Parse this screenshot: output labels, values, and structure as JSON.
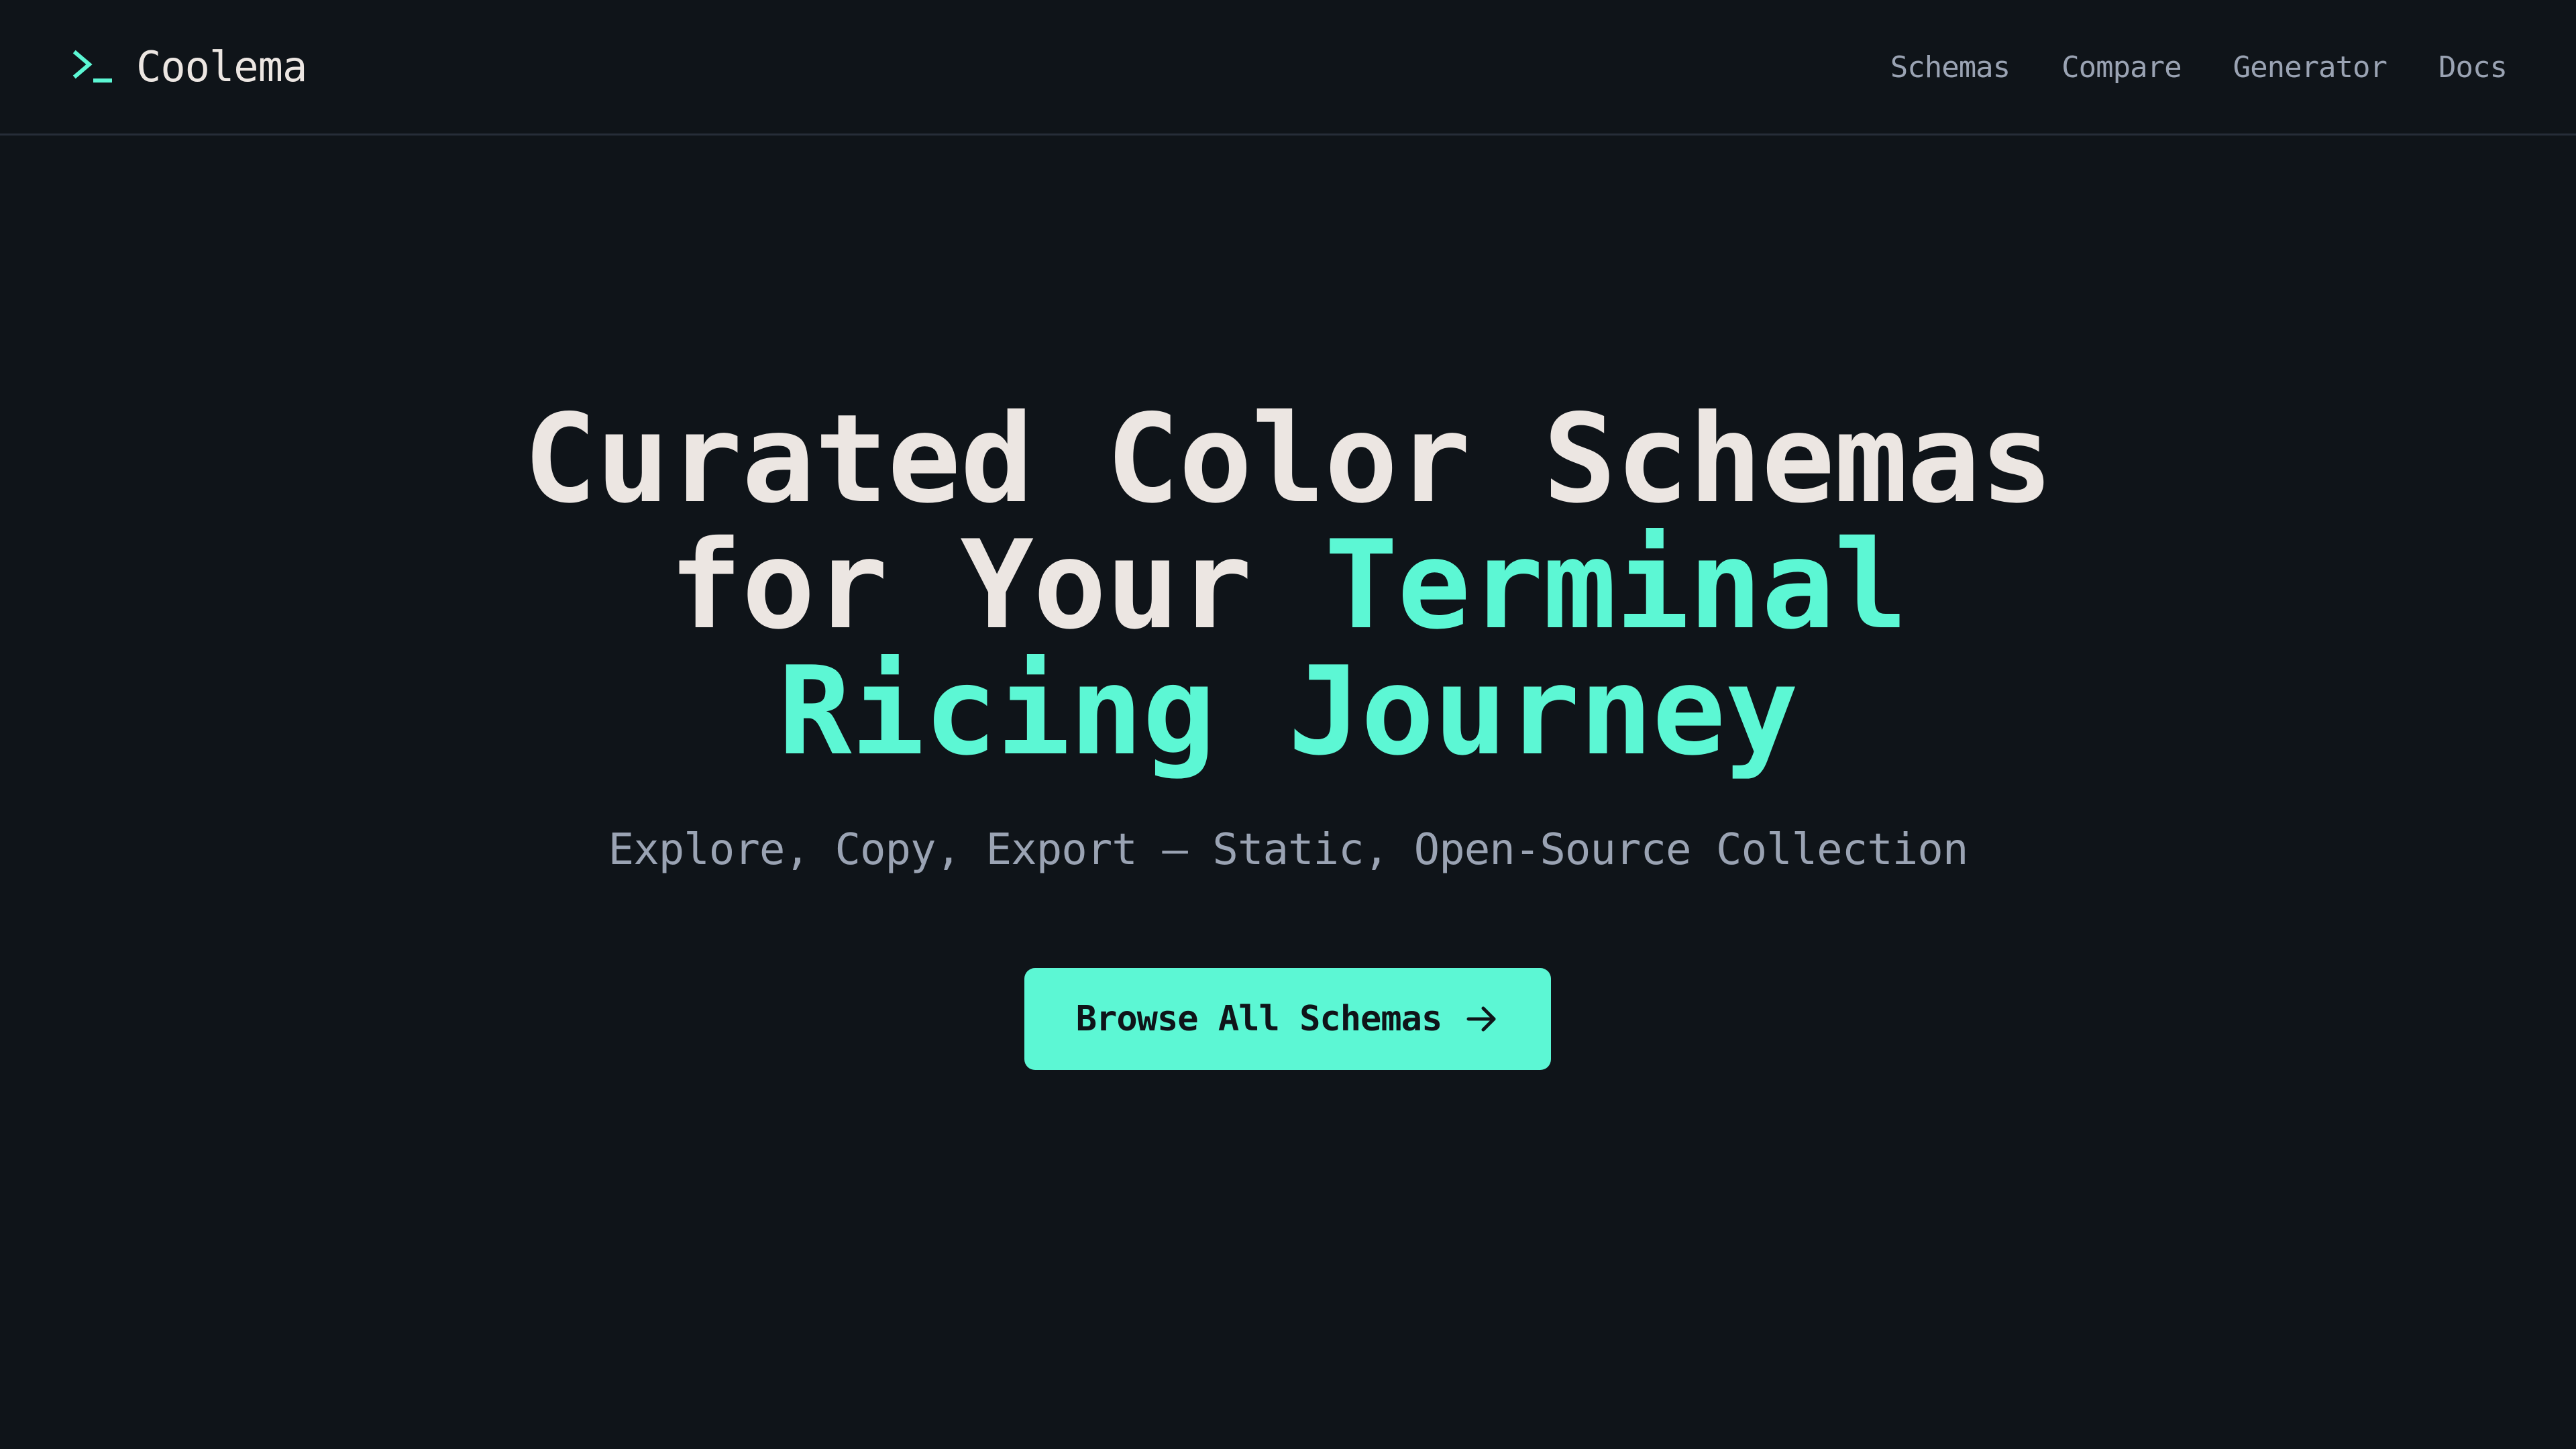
{
  "brand": {
    "name": "Coolema",
    "icon": "terminal-prompt-icon"
  },
  "nav": {
    "items": [
      {
        "label": "Schemas"
      },
      {
        "label": "Compare"
      },
      {
        "label": "Generator"
      },
      {
        "label": "Docs"
      }
    ]
  },
  "hero": {
    "headline_line1": "Curated Color Schemas",
    "headline_line2_plain": "for Your ",
    "headline_line2_accent": "Terminal",
    "headline_line3_accent": "Ricing Journey",
    "subtitle": "Explore, Copy, Export – Static, Open-Source Collection",
    "cta_label": "Browse All Schemas",
    "cta_icon": "arrow-right-icon"
  },
  "colors": {
    "background": "#0f1419",
    "accent": "#5cf7d4",
    "text_primary": "#ece6e2",
    "text_muted": "#9aa3b3",
    "divider": "#262d38"
  }
}
